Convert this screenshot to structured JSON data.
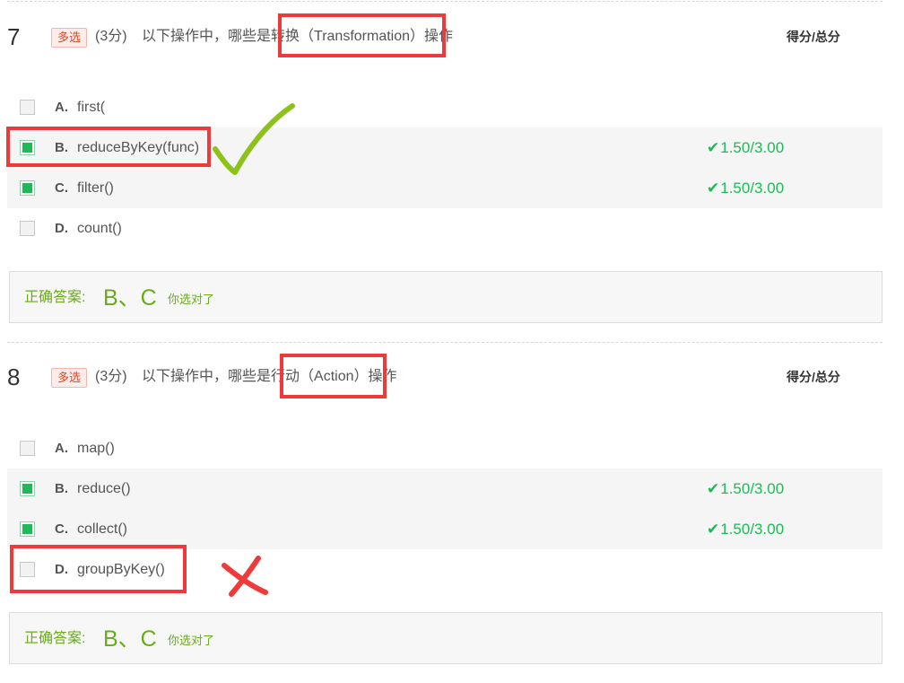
{
  "colors": {
    "correct_green": "#1dbb55",
    "answer_green": "#6aaa1b",
    "annotation_red": "#ee3a3a",
    "annotation_lime": "#8cc21a"
  },
  "questions": [
    {
      "number": "7",
      "type_badge": "多选",
      "score": "(3分)",
      "text_before": "以下操作中，哪些是",
      "highlight": "转换（Transformation）",
      "text_after": "操作",
      "score_header": "得分/总分",
      "options": [
        {
          "letter": "A.",
          "text": "first(",
          "checked": false,
          "score": ""
        },
        {
          "letter": "B.",
          "text": "reduceByKey(func)",
          "checked": true,
          "score": "1.50/3.00"
        },
        {
          "letter": "C.",
          "text": "filter()",
          "checked": true,
          "score": "1.50/3.00"
        },
        {
          "letter": "D.",
          "text": "count()",
          "checked": false,
          "score": ""
        }
      ],
      "answer_label": "正确答案:",
      "answer_value": "B、C",
      "answer_result": "你选对了",
      "annotation": "check-mark"
    },
    {
      "number": "8",
      "type_badge": "多选",
      "score": "(3分)",
      "text_before": "以下操作中，哪些是",
      "highlight": "行动（Action）",
      "text_after": "操作",
      "score_header": "得分/总分",
      "options": [
        {
          "letter": "A.",
          "text": "map()",
          "checked": false,
          "score": ""
        },
        {
          "letter": "B.",
          "text": "reduce()",
          "checked": true,
          "score": "1.50/3.00"
        },
        {
          "letter": "C.",
          "text": "collect()",
          "checked": true,
          "score": "1.50/3.00"
        },
        {
          "letter": "D.",
          "text": "groupByKey()",
          "checked": false,
          "score": ""
        }
      ],
      "answer_label": "正确答案:",
      "answer_value": "B、C",
      "answer_result": "你选对了",
      "annotation": "cross-mark"
    }
  ]
}
